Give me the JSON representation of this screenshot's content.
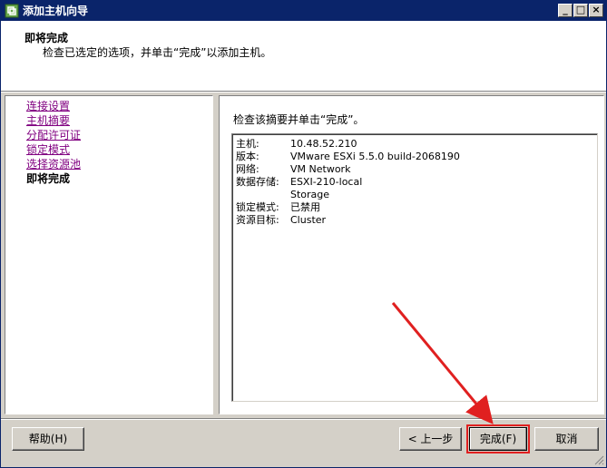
{
  "window": {
    "title": "添加主机向导",
    "minimize_glyph": "_",
    "maximize_glyph": "□",
    "close_glyph": "×"
  },
  "header": {
    "title": "即将完成",
    "subtitle": "检查已选定的选项，并单击“完成”以添加主机。"
  },
  "nav": {
    "items": [
      {
        "label": "连接设置",
        "state": "visited"
      },
      {
        "label": "主机摘要",
        "state": "visited"
      },
      {
        "label": "分配许可证",
        "state": "visited"
      },
      {
        "label": "锁定模式",
        "state": "visited"
      },
      {
        "label": "选择资源池",
        "state": "visited"
      },
      {
        "label": "即将完成",
        "state": "current"
      }
    ]
  },
  "main": {
    "prompt": "检查该摘要并单击“完成”。",
    "summary": [
      {
        "key": "主机:",
        "value": "10.48.52.210"
      },
      {
        "key": "版本:",
        "value": "VMware ESXi 5.5.0 build-2068190"
      },
      {
        "key": "网络:",
        "value": "VM Network"
      },
      {
        "key": "数据存储:",
        "value": "ESXI-210-local"
      },
      {
        "key": "",
        "value": "Storage"
      },
      {
        "key": "锁定模式:",
        "value": "已禁用"
      },
      {
        "key": "资源目标:",
        "value": "Cluster"
      }
    ]
  },
  "footer": {
    "help_label": "帮助(H)",
    "back_label": "< 上一步",
    "finish_label": "完成(F)",
    "cancel_label": "取消"
  },
  "colors": {
    "titlebar": "#0a246a",
    "annotation_red": "#e02020",
    "visited_link": "#800080"
  }
}
